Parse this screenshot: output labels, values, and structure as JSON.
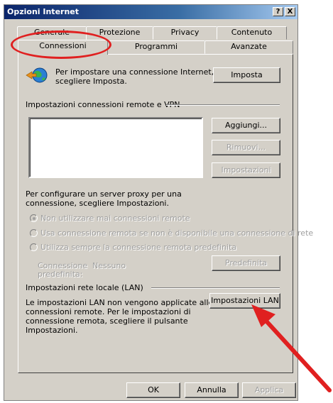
{
  "window": {
    "title": "Opzioni Internet",
    "help_label": "?",
    "close_label": "X"
  },
  "tabs_back": [
    "Generale",
    "Protezione",
    "Privacy",
    "Contenuto"
  ],
  "tabs_front": [
    "Connessioni",
    "Programmi",
    "Avanzate"
  ],
  "active_tab": "Connessioni",
  "setup": {
    "text_line1": "Per impostare una connessione Internet,",
    "text_line2": "scegliere Imposta.",
    "button": "Imposta",
    "icon": "internet-globe-icon"
  },
  "remote": {
    "section_title": "Impostazioni connessioni remote e VPN",
    "add_button": "Aggiungi...",
    "remove_button": "Rimuovi...",
    "settings_button": "Impostazioni"
  },
  "proxy": {
    "line1": "Per configurare un server proxy per una",
    "line2": "connessione, scegliere Impostazioni.",
    "option1": "Non utilizzare mai connessioni remote",
    "option2": "Usa connessione remota se non è disponibile una connessione di rete",
    "option3": "Utilizza sempre la connessione remota predefinita",
    "default_label_line1": "Connessione",
    "default_label_line2": "predefinita:",
    "default_value": "Nessuno",
    "default_button": "Predefinita"
  },
  "lan": {
    "section_title": "Impostazioni rete locale (LAN)",
    "line1": "Le impostazioni LAN non vengono applicate alle",
    "line2": "connessioni remote. Per le impostazioni di",
    "line3": "connessione remota, scegliere il pulsante",
    "line4": "Impostazioni.",
    "button": "Impostazioni LAN"
  },
  "footer": {
    "ok": "OK",
    "cancel": "Annulla",
    "apply": "Applica"
  },
  "annotation_color": "#e02020"
}
